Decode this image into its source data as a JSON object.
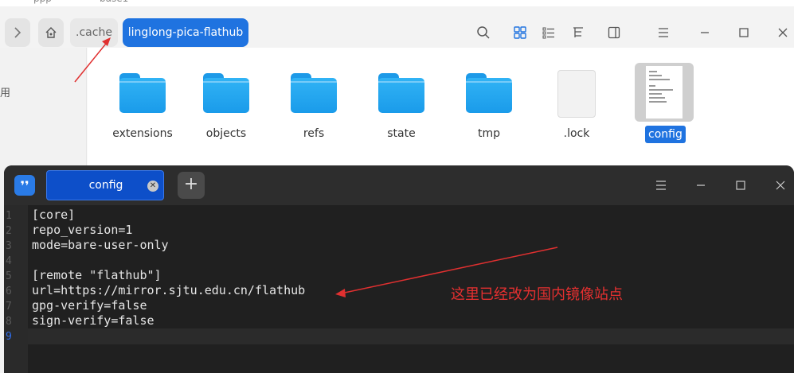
{
  "file_manager": {
    "top_cut_text": [
      "ppp",
      "base1"
    ],
    "breadcrumbs": [
      ".cache",
      "linglong-pica-flathub"
    ],
    "sidebar_fragment": "用",
    "files": [
      {
        "name": "extensions",
        "type": "folder"
      },
      {
        "name": "objects",
        "type": "folder"
      },
      {
        "name": "refs",
        "type": "folder"
      },
      {
        "name": "state",
        "type": "folder"
      },
      {
        "name": "tmp",
        "type": "folder"
      },
      {
        "name": ".lock",
        "type": "file"
      },
      {
        "name": "config",
        "type": "file",
        "selected": true
      }
    ],
    "toolbar_icons": [
      "search-icon",
      "icon-view-icon",
      "list-view-icon",
      "tree-view-icon",
      "detail-panel-icon"
    ],
    "window_controls": [
      "menu-icon",
      "minimize-icon",
      "maximize-icon",
      "close-icon"
    ]
  },
  "editor": {
    "tab_title": "config",
    "new_tab_symbol": "+",
    "line_numbers": [
      "1",
      "2",
      "3",
      "4",
      "5",
      "6",
      "7",
      "8",
      "9"
    ],
    "lines": [
      "[core]",
      "repo_version=1",
      "mode=bare-user-only",
      "",
      "[remote \"flathub\"]",
      "url=https://mirror.sjtu.edu.cn/flathub",
      "gpg-verify=false",
      "sign-verify=false",
      ""
    ],
    "active_line": 9
  },
  "annotation": {
    "text": "这里已经改为国内镜像站点",
    "color": "#e63030"
  },
  "colors": {
    "accent": "#1f73e0",
    "editor_bg": "#202020"
  }
}
